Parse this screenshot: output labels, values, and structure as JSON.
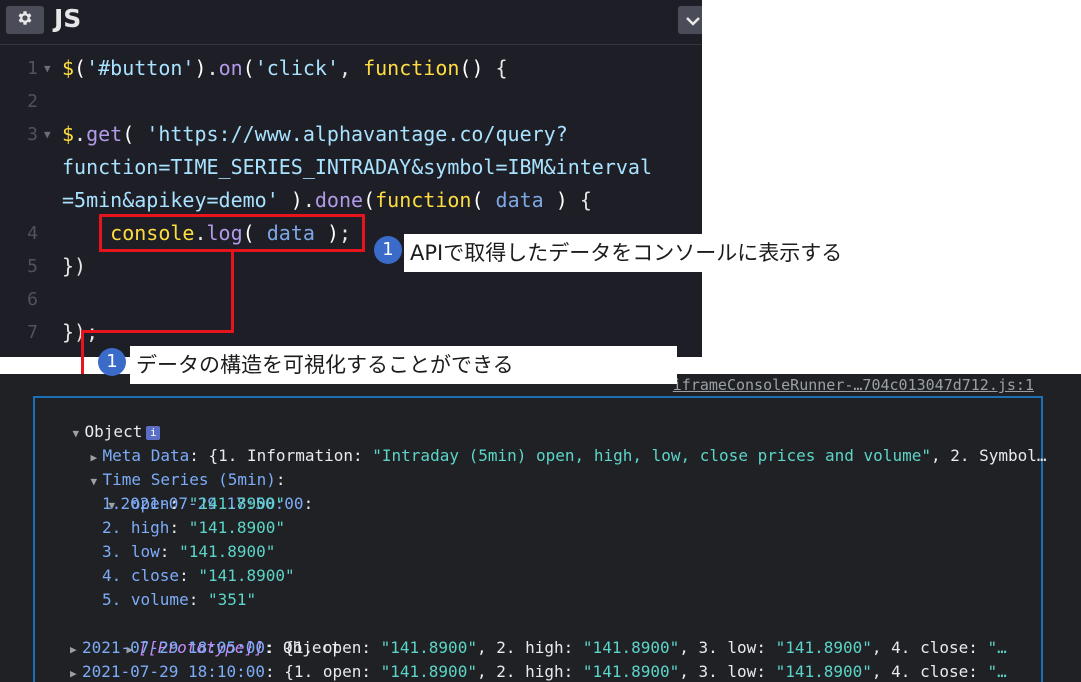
{
  "editor": {
    "language_label": "JS",
    "gear_icon": "gear-icon",
    "chevron_icon": "chevron-down-icon",
    "lines": [
      {
        "num": "1",
        "parts": [
          [
            "c-fn",
            "$"
          ],
          [
            "c-paren",
            "("
          ],
          [
            "c-str",
            "'#button'"
          ],
          [
            "c-paren",
            ")"
          ],
          [
            "c-plain",
            "."
          ],
          [
            "c-prop",
            "on"
          ],
          [
            "c-paren",
            "("
          ],
          [
            "c-str",
            "'click'"
          ],
          [
            "c-plain",
            ", "
          ],
          [
            "c-fn",
            "function"
          ],
          [
            "c-paren",
            "()"
          ],
          [
            "c-plain",
            " {"
          ]
        ]
      },
      {
        "num": "2",
        "parts": []
      },
      {
        "num": "3",
        "parts": [
          [
            "c-fn",
            "$"
          ],
          [
            "c-plain",
            "."
          ],
          [
            "c-prop",
            "get"
          ],
          [
            "c-paren",
            "("
          ],
          [
            "c-plain",
            " "
          ],
          [
            "c-str",
            "'https://www.alphavantage.co/query?"
          ]
        ]
      },
      {
        "num": "",
        "parts": [
          [
            "c-str",
            "function=TIME_SERIES_INTRADAY&symbol=IBM&interval"
          ]
        ]
      },
      {
        "num": "",
        "parts": [
          [
            "c-str",
            "=5min&apikey=demo'"
          ],
          [
            "c-plain",
            " "
          ],
          [
            "c-paren",
            ")"
          ],
          [
            "c-plain",
            "."
          ],
          [
            "c-prop",
            "done"
          ],
          [
            "c-paren",
            "("
          ],
          [
            "c-fn",
            "function"
          ],
          [
            "c-paren",
            "("
          ],
          [
            "c-plain",
            " "
          ],
          [
            "c-var",
            "data"
          ],
          [
            "c-plain",
            " "
          ],
          [
            "c-paren",
            ")"
          ],
          [
            "c-plain",
            " {"
          ]
        ]
      },
      {
        "num": "4",
        "parts": [
          [
            "c-plain",
            "    "
          ],
          [
            "c-fn",
            "console"
          ],
          [
            "c-plain",
            "."
          ],
          [
            "c-prop",
            "log"
          ],
          [
            "c-paren",
            "("
          ],
          [
            "c-plain",
            " "
          ],
          [
            "c-var",
            "data"
          ],
          [
            "c-plain",
            " "
          ],
          [
            "c-paren",
            ")"
          ],
          [
            "c-plain",
            ";"
          ]
        ]
      },
      {
        "num": "5",
        "parts": [
          [
            "c-plain",
            "})"
          ]
        ]
      },
      {
        "num": "6",
        "parts": []
      },
      {
        "num": "7",
        "parts": [
          [
            "c-plain",
            "});"
          ]
        ]
      }
    ]
  },
  "annotations": {
    "badge_1": "1",
    "callout_1": "APIで取得したデータをコンソールに表示する",
    "badge_2": "1",
    "callout_2": "データの構造を可視化することができる"
  },
  "console": {
    "source_link": "iframeConsoleRunner-…704c013047d712.js:1",
    "object_label": "Object",
    "info_icon": "i",
    "meta_key": "Meta Data",
    "meta_prefix": ": {1. Information: ",
    "meta_value": "\"Intraday (5min) open, high, low, close prices and volume\"",
    "meta_suffix": ", 2. Symbol…",
    "series_key": "Time Series (5min)",
    "series_suffix": ":",
    "entry_1_key": "2021-07-29 17:50:00",
    "entry_1_suffix": ":",
    "fields": [
      {
        "key": "1. open",
        "value": "\"141.8900\""
      },
      {
        "key": "2. high",
        "value": "\"141.8900\""
      },
      {
        "key": "3. low",
        "value": "\"141.8900\""
      },
      {
        "key": "4. close",
        "value": "\"141.8900\""
      },
      {
        "key": "5. volume",
        "value": "\"351\""
      }
    ],
    "prototype_key": "[[Prototype]]",
    "prototype_value": ": Object",
    "collapsed_rows": [
      {
        "key": "2021-07-29 18:05:00",
        "rest": ": {1. open: ",
        "v1": "\"141.8900\"",
        "s1": ", 2. high: ",
        "v2": "\"141.8900\"",
        "s2": ", 3. low: ",
        "v3": "\"141.8900\"",
        "s3": ", 4. close: ",
        "v4": "\"…"
      },
      {
        "key": "2021-07-29 18:10:00",
        "rest": ": {1. open: ",
        "v1": "\"141.8900\"",
        "s1": ", 2. high: ",
        "v2": "\"141.8900\"",
        "s2": ", 3. low: ",
        "v3": "\"141.8900\"",
        "s3": ", 4. close: ",
        "v4": "\"…"
      }
    ]
  }
}
